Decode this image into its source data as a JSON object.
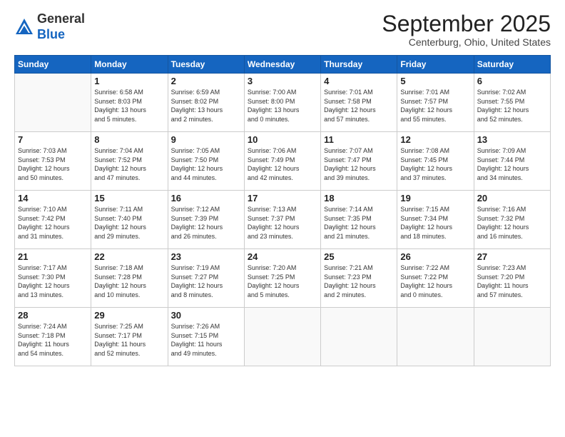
{
  "logo": {
    "general": "General",
    "blue": "Blue"
  },
  "header": {
    "month": "September 2025",
    "location": "Centerburg, Ohio, United States"
  },
  "weekdays": [
    "Sunday",
    "Monday",
    "Tuesday",
    "Wednesday",
    "Thursday",
    "Friday",
    "Saturday"
  ],
  "weeks": [
    [
      {
        "day": "",
        "info": ""
      },
      {
        "day": "1",
        "info": "Sunrise: 6:58 AM\nSunset: 8:03 PM\nDaylight: 13 hours\nand 5 minutes."
      },
      {
        "day": "2",
        "info": "Sunrise: 6:59 AM\nSunset: 8:02 PM\nDaylight: 13 hours\nand 2 minutes."
      },
      {
        "day": "3",
        "info": "Sunrise: 7:00 AM\nSunset: 8:00 PM\nDaylight: 13 hours\nand 0 minutes."
      },
      {
        "day": "4",
        "info": "Sunrise: 7:01 AM\nSunset: 7:58 PM\nDaylight: 12 hours\nand 57 minutes."
      },
      {
        "day": "5",
        "info": "Sunrise: 7:01 AM\nSunset: 7:57 PM\nDaylight: 12 hours\nand 55 minutes."
      },
      {
        "day": "6",
        "info": "Sunrise: 7:02 AM\nSunset: 7:55 PM\nDaylight: 12 hours\nand 52 minutes."
      }
    ],
    [
      {
        "day": "7",
        "info": "Sunrise: 7:03 AM\nSunset: 7:53 PM\nDaylight: 12 hours\nand 50 minutes."
      },
      {
        "day": "8",
        "info": "Sunrise: 7:04 AM\nSunset: 7:52 PM\nDaylight: 12 hours\nand 47 minutes."
      },
      {
        "day": "9",
        "info": "Sunrise: 7:05 AM\nSunset: 7:50 PM\nDaylight: 12 hours\nand 44 minutes."
      },
      {
        "day": "10",
        "info": "Sunrise: 7:06 AM\nSunset: 7:49 PM\nDaylight: 12 hours\nand 42 minutes."
      },
      {
        "day": "11",
        "info": "Sunrise: 7:07 AM\nSunset: 7:47 PM\nDaylight: 12 hours\nand 39 minutes."
      },
      {
        "day": "12",
        "info": "Sunrise: 7:08 AM\nSunset: 7:45 PM\nDaylight: 12 hours\nand 37 minutes."
      },
      {
        "day": "13",
        "info": "Sunrise: 7:09 AM\nSunset: 7:44 PM\nDaylight: 12 hours\nand 34 minutes."
      }
    ],
    [
      {
        "day": "14",
        "info": "Sunrise: 7:10 AM\nSunset: 7:42 PM\nDaylight: 12 hours\nand 31 minutes."
      },
      {
        "day": "15",
        "info": "Sunrise: 7:11 AM\nSunset: 7:40 PM\nDaylight: 12 hours\nand 29 minutes."
      },
      {
        "day": "16",
        "info": "Sunrise: 7:12 AM\nSunset: 7:39 PM\nDaylight: 12 hours\nand 26 minutes."
      },
      {
        "day": "17",
        "info": "Sunrise: 7:13 AM\nSunset: 7:37 PM\nDaylight: 12 hours\nand 23 minutes."
      },
      {
        "day": "18",
        "info": "Sunrise: 7:14 AM\nSunset: 7:35 PM\nDaylight: 12 hours\nand 21 minutes."
      },
      {
        "day": "19",
        "info": "Sunrise: 7:15 AM\nSunset: 7:34 PM\nDaylight: 12 hours\nand 18 minutes."
      },
      {
        "day": "20",
        "info": "Sunrise: 7:16 AM\nSunset: 7:32 PM\nDaylight: 12 hours\nand 16 minutes."
      }
    ],
    [
      {
        "day": "21",
        "info": "Sunrise: 7:17 AM\nSunset: 7:30 PM\nDaylight: 12 hours\nand 13 minutes."
      },
      {
        "day": "22",
        "info": "Sunrise: 7:18 AM\nSunset: 7:28 PM\nDaylight: 12 hours\nand 10 minutes."
      },
      {
        "day": "23",
        "info": "Sunrise: 7:19 AM\nSunset: 7:27 PM\nDaylight: 12 hours\nand 8 minutes."
      },
      {
        "day": "24",
        "info": "Sunrise: 7:20 AM\nSunset: 7:25 PM\nDaylight: 12 hours\nand 5 minutes."
      },
      {
        "day": "25",
        "info": "Sunrise: 7:21 AM\nSunset: 7:23 PM\nDaylight: 12 hours\nand 2 minutes."
      },
      {
        "day": "26",
        "info": "Sunrise: 7:22 AM\nSunset: 7:22 PM\nDaylight: 12 hours\nand 0 minutes."
      },
      {
        "day": "27",
        "info": "Sunrise: 7:23 AM\nSunset: 7:20 PM\nDaylight: 11 hours\nand 57 minutes."
      }
    ],
    [
      {
        "day": "28",
        "info": "Sunrise: 7:24 AM\nSunset: 7:18 PM\nDaylight: 11 hours\nand 54 minutes."
      },
      {
        "day": "29",
        "info": "Sunrise: 7:25 AM\nSunset: 7:17 PM\nDaylight: 11 hours\nand 52 minutes."
      },
      {
        "day": "30",
        "info": "Sunrise: 7:26 AM\nSunset: 7:15 PM\nDaylight: 11 hours\nand 49 minutes."
      },
      {
        "day": "",
        "info": ""
      },
      {
        "day": "",
        "info": ""
      },
      {
        "day": "",
        "info": ""
      },
      {
        "day": "",
        "info": ""
      }
    ]
  ]
}
